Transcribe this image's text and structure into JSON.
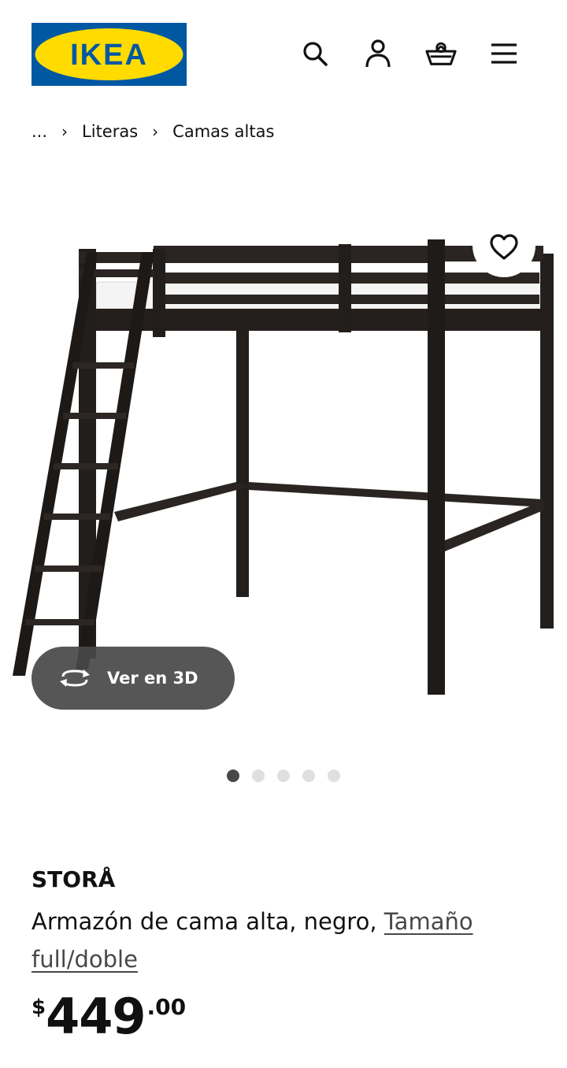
{
  "header": {
    "logo_text": "IKEA",
    "brand_colors": {
      "blue": "#0058a3",
      "yellow": "#ffdb00"
    },
    "icons": [
      "search-icon",
      "user-icon",
      "shopping-basket-icon",
      "menu-icon"
    ]
  },
  "breadcrumb": {
    "ellipsis": "...",
    "items": [
      "Literas",
      "Camas altas"
    ]
  },
  "gallery": {
    "view_3d_label": "Ver en 3D",
    "slide_count": 5,
    "active_slide": 1
  },
  "product": {
    "name": "STORÅ",
    "description": "Armazón de cama alta, negro, ",
    "size_link": "Tamaño full/doble",
    "price": {
      "currency": "$",
      "integer": "449",
      "decimals": ".00"
    }
  }
}
